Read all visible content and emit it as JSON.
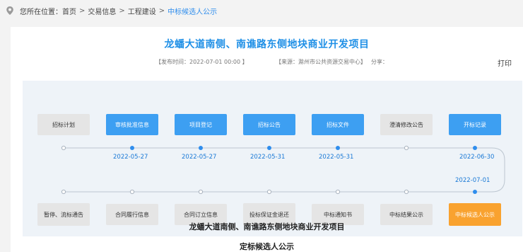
{
  "breadcrumb": {
    "prefix": "您所在位置：",
    "items": [
      "首页",
      "交易信息",
      "工程建设"
    ],
    "separator": ">",
    "current": "中标候选人公示"
  },
  "article": {
    "title": "龙蟠大道南侧、南谯路东侧地块商业开发项目",
    "publish_time": "【发布时间：2022-07-01 00:00 】",
    "source": "【来源：滁州市公共资源交易中心】",
    "share_label": "分享：",
    "print_label": "打印"
  },
  "flow": {
    "top_steps": [
      {
        "label": "招标计划",
        "state": "inactive"
      },
      {
        "label": "审核批准信息",
        "state": "active"
      },
      {
        "label": "项目登记",
        "state": "active"
      },
      {
        "label": "招标公告",
        "state": "active"
      },
      {
        "label": "招标文件",
        "state": "active"
      },
      {
        "label": "澄清修改公告",
        "state": "inactive"
      },
      {
        "label": "开标记录",
        "state": "active"
      }
    ],
    "top_dates": [
      "",
      "2022-05-27",
      "2022-05-27",
      "2022-05-31",
      "2022-05-31",
      "",
      "2022-06-30"
    ],
    "bottom_steps": [
      {
        "label": "暂停、流标通告",
        "state": "inactive"
      },
      {
        "label": "合同履行信息",
        "state": "inactive"
      },
      {
        "label": "合同订立信息",
        "state": "inactive"
      },
      {
        "label": "投标保证金退还",
        "state": "inactive"
      },
      {
        "label": "中标通知书",
        "state": "inactive"
      },
      {
        "label": "中标结果公示",
        "state": "inactive"
      },
      {
        "label": "中标候选人公示",
        "state": "current"
      }
    ],
    "bottom_date": "2022-07-01",
    "colors": {
      "active": "#3d9ff2",
      "inactive": "#e5e5e5",
      "current": "#f9a22f",
      "date": "#1a79d6"
    }
  },
  "document": {
    "title": "龙蟠大道南侧、南谯路东侧地块商业开发项目",
    "subtitle": "定标候选人公示"
  }
}
